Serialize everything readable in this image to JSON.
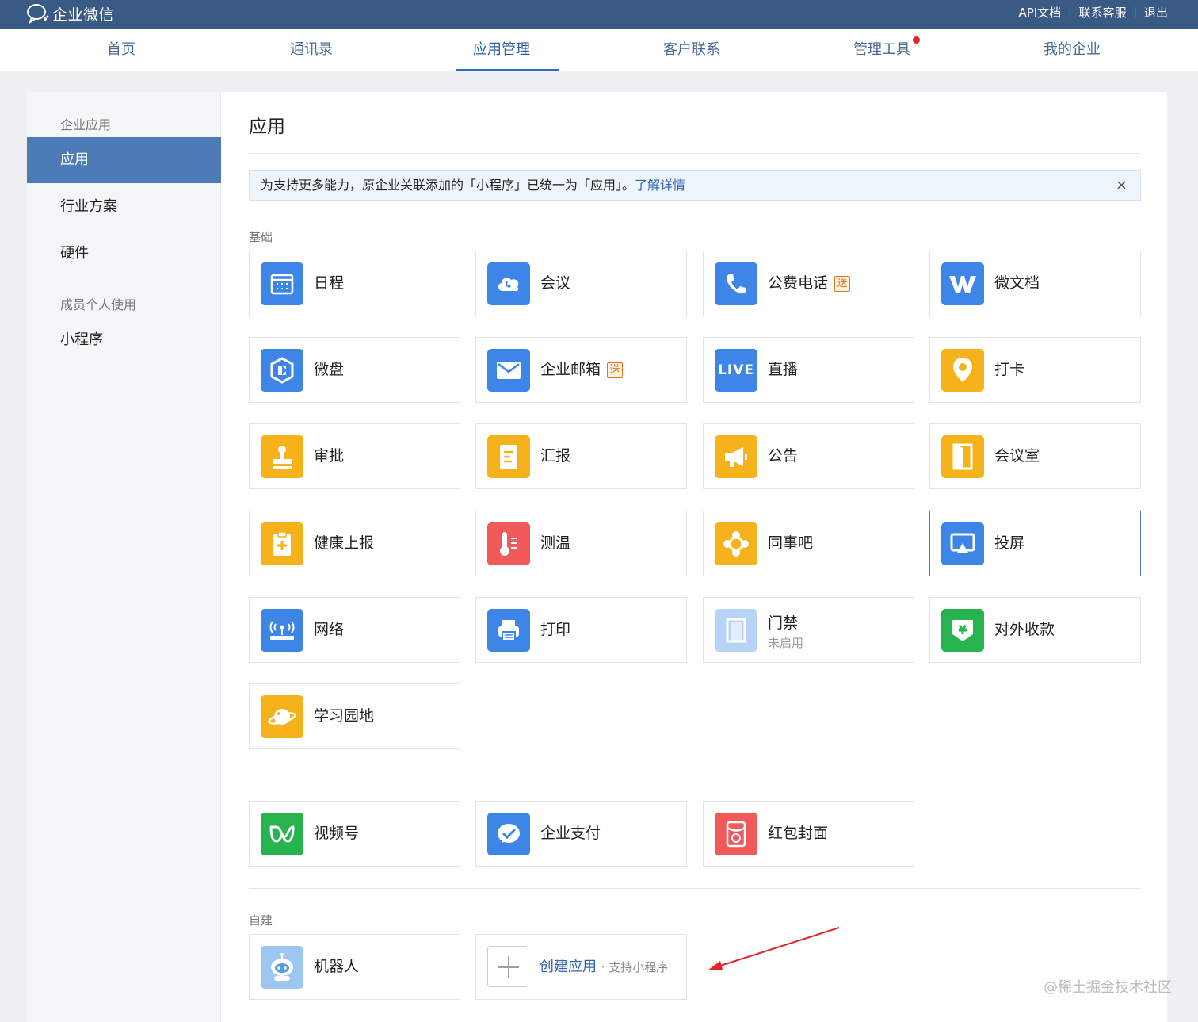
{
  "brand": {
    "name": "企业微信",
    "logo_icon": "wecom-logo-icon"
  },
  "top_links": [
    "API文档",
    "联系客服",
    "退出"
  ],
  "nav": {
    "items": [
      {
        "label": "首页"
      },
      {
        "label": "通讯录"
      },
      {
        "label": "应用管理",
        "active": true
      },
      {
        "label": "客户联系"
      },
      {
        "label": "管理工具",
        "has_dot": true
      },
      {
        "label": "我的企业"
      }
    ]
  },
  "sidebar": {
    "group_enterprise": "企业应用",
    "items_enterprise": [
      {
        "label": "应用",
        "active": true
      },
      {
        "label": "行业方案"
      },
      {
        "label": "硬件"
      }
    ],
    "group_personal": "成员个人使用",
    "items_personal": [
      {
        "label": "小程序"
      }
    ]
  },
  "content": {
    "title": "应用",
    "notice": {
      "text": "为支持更多能力，原企业关联添加的「小程序」已统一为「应用」。",
      "link": "了解详情",
      "close": "×"
    },
    "section_basic": "基础",
    "basic_apps": [
      {
        "label": "日程",
        "icon": "calendar-icon",
        "color": "#3d86e8"
      },
      {
        "label": "会议",
        "icon": "meeting-icon",
        "color": "#3d86e8"
      },
      {
        "label": "公费电话",
        "icon": "phone-icon",
        "color": "#3d86e8",
        "badge": "送"
      },
      {
        "label": "微文档",
        "icon": "doc-icon",
        "color": "#3d86e8"
      },
      {
        "label": "微盘",
        "icon": "drive-icon",
        "color": "#3d86e8"
      },
      {
        "label": "企业邮箱",
        "icon": "mail-icon",
        "color": "#3d86e8",
        "badge": "送"
      },
      {
        "label": "直播",
        "icon": "live-icon",
        "color": "#3d86e8",
        "icon_text": "LIVE"
      },
      {
        "label": "打卡",
        "icon": "location-pin-icon",
        "color": "#f6b21a"
      },
      {
        "label": "审批",
        "icon": "stamp-icon",
        "color": "#f6b21a"
      },
      {
        "label": "汇报",
        "icon": "report-icon",
        "color": "#f6b21a"
      },
      {
        "label": "公告",
        "icon": "megaphone-icon",
        "color": "#f6b21a"
      },
      {
        "label": "会议室",
        "icon": "door-icon",
        "color": "#f6b21a"
      },
      {
        "label": "健康上报",
        "icon": "health-icon",
        "color": "#f6b21a"
      },
      {
        "label": "测温",
        "icon": "thermometer-icon",
        "color": "#f05a5a"
      },
      {
        "label": "同事吧",
        "icon": "colleague-icon",
        "color": "#f6b21a"
      },
      {
        "label": "投屏",
        "icon": "screencast-icon",
        "color": "#3d86e8",
        "selected": true
      },
      {
        "label": "网络",
        "icon": "wifi-router-icon",
        "color": "#3d86e8"
      },
      {
        "label": "打印",
        "icon": "printer-icon",
        "color": "#3d86e8"
      },
      {
        "label": "门禁",
        "icon": "access-door-icon",
        "color": "#b7d3f6",
        "sub": "未启用"
      },
      {
        "label": "对外收款",
        "icon": "payment-icon",
        "color": "#27b34d"
      },
      {
        "label": "学习园地",
        "icon": "planet-icon",
        "color": "#f6b21a"
      }
    ],
    "extra_apps": [
      {
        "label": "视频号",
        "icon": "channels-icon",
        "color": "#27b34d"
      },
      {
        "label": "企业支付",
        "icon": "enterprise-pay-icon",
        "color": "#3d86e8"
      },
      {
        "label": "红包封面",
        "icon": "red-packet-icon",
        "color": "#f05a5a"
      }
    ],
    "section_custom": "自建",
    "custom_apps": [
      {
        "label": "机器人",
        "icon": "robot-icon",
        "color": "#9cc7f2"
      }
    ],
    "create": {
      "label": "创建应用",
      "sub": "· 支持小程序"
    }
  },
  "watermark": "@稀土掘金技术社区"
}
